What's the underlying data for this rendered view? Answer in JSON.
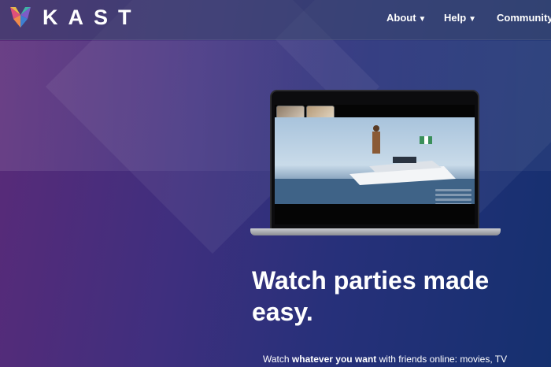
{
  "brand": {
    "name": "KAST",
    "logo_icon": "kast-fox-logo-icon"
  },
  "nav": {
    "items": [
      {
        "label": "About",
        "icon": "caret-down-icon"
      },
      {
        "label": "Help",
        "icon": "caret-down-icon"
      },
      {
        "label": "Community",
        "icon": "caret-down-icon"
      }
    ]
  },
  "hero": {
    "headline": "Watch parties made easy.",
    "subline_prefix": "Watch ",
    "subline_emphasis": "whatever you want",
    "subline_suffix": " with friends online: movies, TV"
  },
  "colors": {
    "background_start": "#5b2a78",
    "background_end": "#15306f",
    "text": "#ffffff"
  }
}
